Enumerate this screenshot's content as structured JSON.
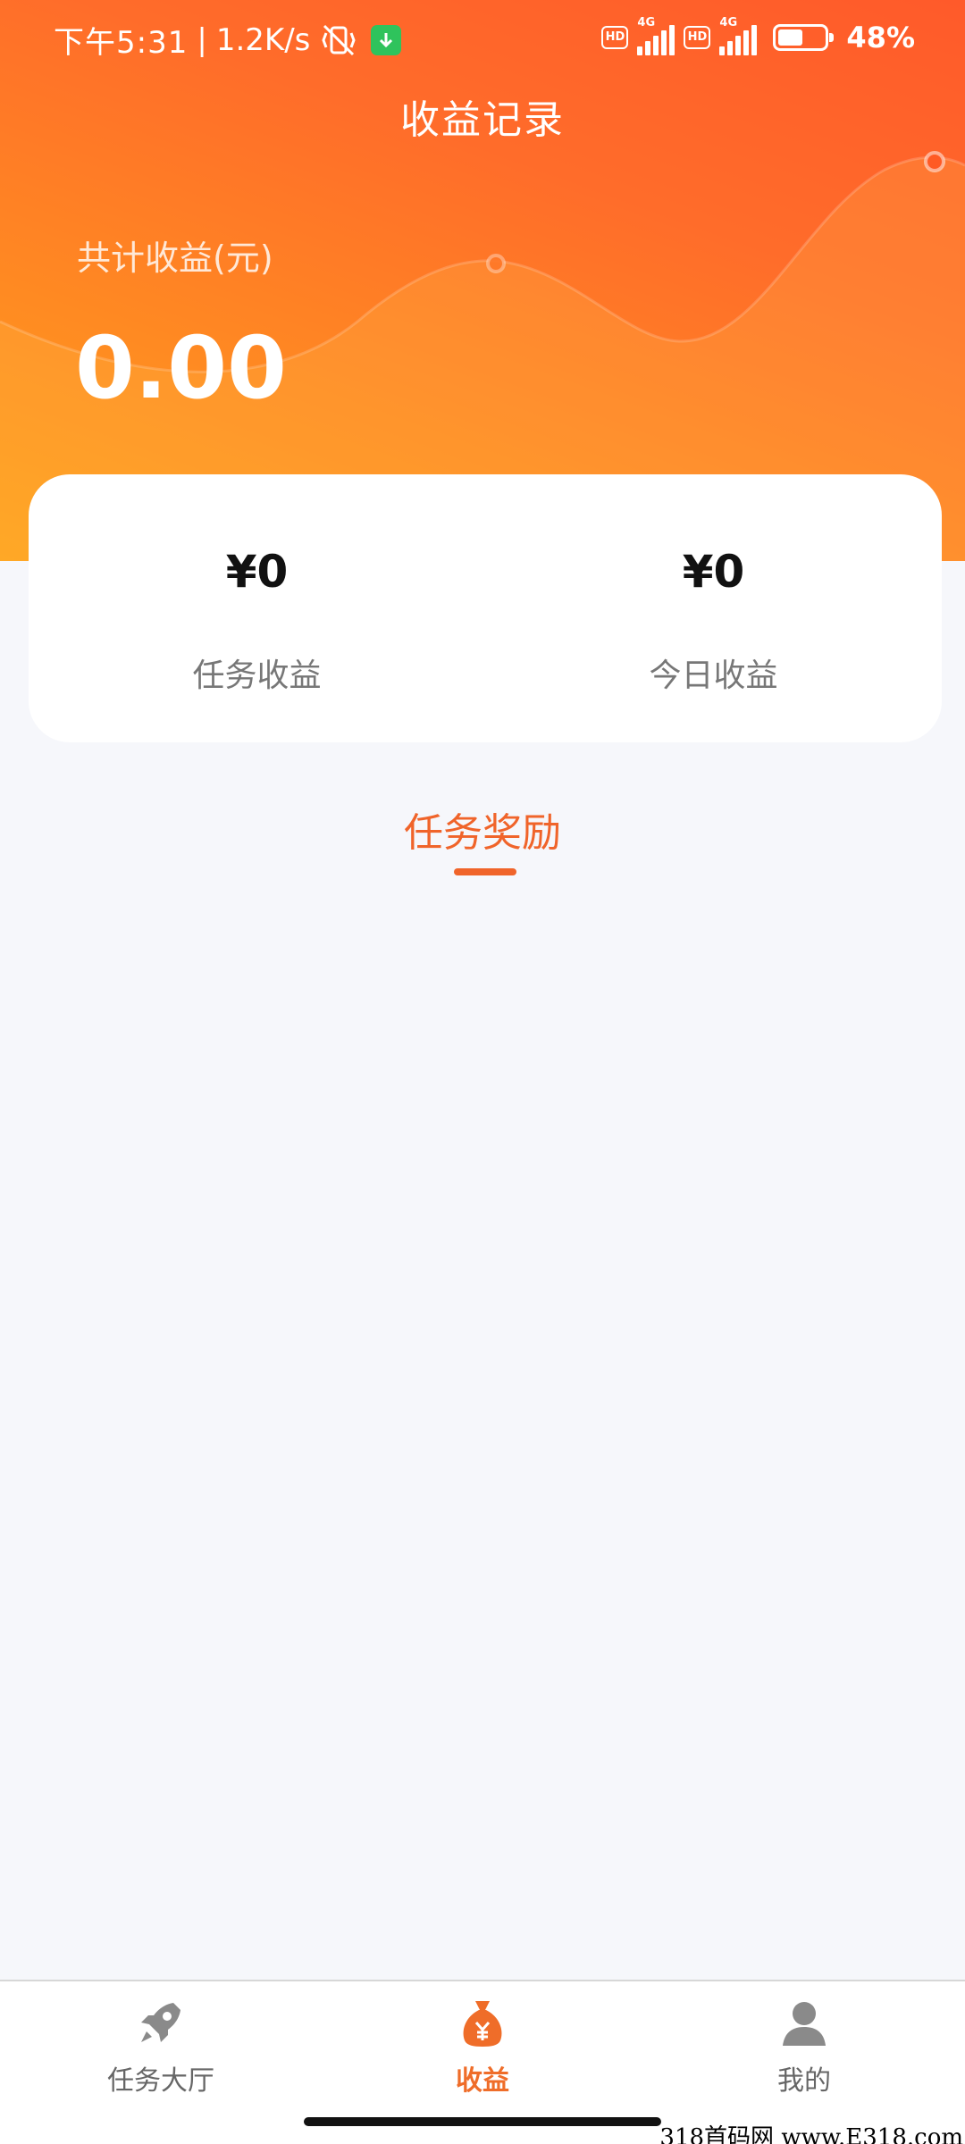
{
  "status_bar": {
    "time": "下午5:31",
    "separator": "|",
    "net_speed": "1.2K/s",
    "hd_label": "HD",
    "network_type": "4G",
    "battery": "48%",
    "battery_level": 0.48
  },
  "header": {
    "title": "收益记录",
    "total_label": "共计收益(元)",
    "total_value": "0.00"
  },
  "summary": {
    "task_income_amount": "¥0",
    "task_income_label": "任务收益",
    "today_income_amount": "¥0",
    "today_income_label": "今日收益"
  },
  "tabs": {
    "active_label": "任务奖励"
  },
  "bottom_nav": {
    "items": [
      {
        "label": "任务大厅",
        "icon": "rocket-icon",
        "active": false
      },
      {
        "label": "收益",
        "icon": "money-bag-icon",
        "active": true
      },
      {
        "label": "我的",
        "icon": "user-icon",
        "active": false
      }
    ]
  },
  "watermark": "318首码网 www.E318.com",
  "colors": {
    "accent": "#f0642a",
    "header_start": "#ff5a2a",
    "header_end": "#ffa21a",
    "background": "#f6f7fb"
  }
}
